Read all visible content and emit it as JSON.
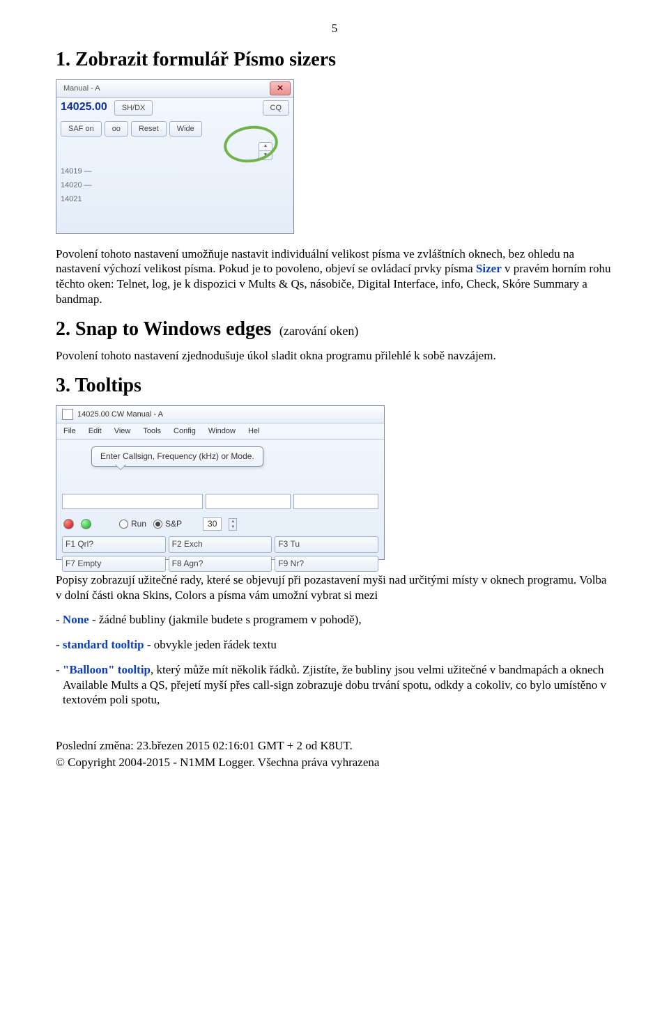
{
  "page_number": "5",
  "h1": {
    "num": "1.",
    "title": "Zobrazit formulář Písmo sizers"
  },
  "p1": "Povolení tohoto nastavení umožňuje nastavit individuální velikost písma ve zvláštních oknech, bez ohledu na nastavení výchozí velikost písma. Pokud je to povoleno, objeví se ovládací prvky písma ",
  "p1_blue": "Sizer",
  "p1_after": " v pravém horním rohu těchto oken: Telnet, log, je k dispozici v Mults & Qs, násobiče, Digital Interface, info, Check, Skóre Summary a bandmap.",
  "h2": {
    "num": "2.",
    "title": "Snap to Windows edges",
    "paren": "(zarování oken)"
  },
  "p2": "Povolení tohoto nastavení zjednodušuje úkol sladit okna programu přilehlé k sobě navzájem.",
  "h3": {
    "num": "3.",
    "title": "Tooltips"
  },
  "p3a": "Popisy zobrazují užitečné rady, které se objevují při pozastavení myši nad určitými místy v oknech programu. Volba v dolní části okna Skins, Colors a  písma vám umožní vybrat si mezi",
  "li1_pre": "- ",
  "li1_key": "None",
  "li1_rest": " - žádné bubliny (jakmile budete s programem v pohodě),",
  "li2_pre": "- ",
  "li2_key": "standard  tooltip",
  "li2_rest": " - obvykle jeden řádek textu",
  "li3_pre": "- ",
  "li3_key": "\"Balloon\" tooltip",
  "li3_rest": ", který může mít několik řádků. Zjistíte, že bubliny jsou velmi užitečné v bandmapách a oknech Available Mults a QS, přejetí myší přes call-sign zobrazuje dobu trvání spotu, odkdy a cokoliv, co bylo umístěno v textovém poli spotu,",
  "footer1": "Poslední změna: 23.březen 2015 02:16:01 GMT + 2 od K8UT.",
  "footer2": "© Copyright 2004-2015 - N1MM Logger. Všechna práva vyhrazena",
  "sc1": {
    "title": "Manual - A",
    "freq": "14025.00",
    "btn_shdx": "SH/DX",
    "btn_cq": "CQ",
    "btn_saf": "SAF on",
    "btn_oo": "oo",
    "btn_reset": "Reset",
    "btn_wide": "Wide",
    "mark1": "14019",
    "mark2": "14020",
    "mark3": "14021"
  },
  "sc2": {
    "title": "14025.00 CW Manual - A",
    "menu": [
      "File",
      "Edit",
      "View",
      "Tools",
      "Config",
      "Window",
      "Hel"
    ],
    "tooltip": "Enter Callsign, Frequency (kHz) or Mode.",
    "run": "Run",
    "sp": "S&P",
    "num": "30",
    "fkeys1": [
      "F1 Qrl?",
      "F2 Exch",
      "F3 Tu"
    ],
    "fkeys2": [
      "F7 Empty",
      "F8 Agn?",
      "F9 Nr?"
    ]
  }
}
